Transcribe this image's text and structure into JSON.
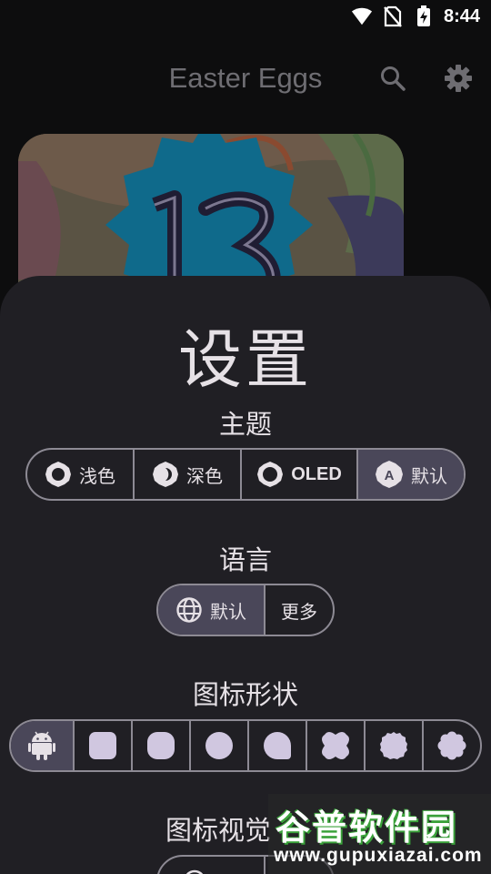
{
  "status_bar": {
    "time": "8:44",
    "icons": [
      "wifi-icon",
      "no-sim-icon",
      "battery-charging-icon"
    ]
  },
  "app_bar": {
    "title": "Easter Eggs",
    "icons": [
      "search-icon",
      "settings-icon"
    ]
  },
  "card": {
    "badge_number": "13",
    "colors": {
      "badge": "#0f6a8b",
      "digits": "#1f1d33"
    }
  },
  "sheet": {
    "title": "设置",
    "theme": {
      "title": "主题",
      "options": [
        {
          "label": "浅色",
          "icon": "light-mode-icon",
          "selected": false
        },
        {
          "label": "深色",
          "icon": "dark-mode-icon",
          "selected": false
        },
        {
          "label": "OLED",
          "icon": "oled-mode-icon",
          "selected": false
        },
        {
          "label": "默认",
          "icon": "auto-mode-icon",
          "icon_letter": "A",
          "selected": true
        }
      ]
    },
    "language": {
      "title": "语言",
      "options": [
        {
          "label": "默认",
          "icon": "globe-icon",
          "selected": true
        },
        {
          "label": "更多",
          "selected": false
        }
      ]
    },
    "icon_shape": {
      "title": "图标形状",
      "options": [
        {
          "name": "android-default",
          "icon": "android-icon",
          "selected": true
        },
        {
          "name": "rounded-square",
          "selected": false
        },
        {
          "name": "squircle",
          "selected": false
        },
        {
          "name": "circle",
          "selected": false
        },
        {
          "name": "teardrop",
          "selected": false
        },
        {
          "name": "clover",
          "selected": false
        },
        {
          "name": "scalloped",
          "selected": false
        },
        {
          "name": "flower",
          "selected": false
        }
      ]
    },
    "icon_visual": {
      "title": "图标视觉"
    }
  },
  "watermark": {
    "title": "谷普软件园",
    "url": "www.gupuxiazai.com"
  },
  "colors": {
    "background": "#0d0d0e",
    "sheet": "#201f24",
    "segment_selected": "#4a4759",
    "segment_border": "#8d8a94",
    "shape_fill": "#d0c7e0",
    "text": "#e6e1e6",
    "title_muted": "#6e6d72"
  }
}
